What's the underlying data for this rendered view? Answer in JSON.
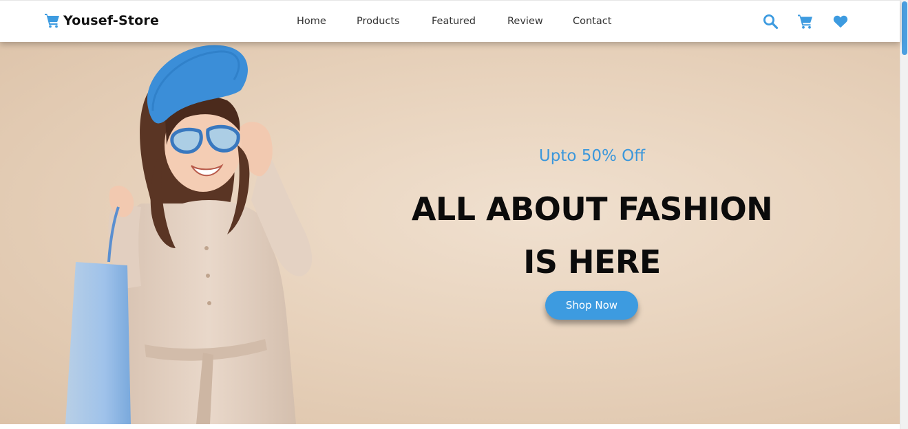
{
  "header": {
    "logo_text": "Yousef-Store",
    "logo_icon": "shopping-cart-icon",
    "nav": [
      {
        "label": "Home"
      },
      {
        "label": "Products"
      },
      {
        "label": "Featured"
      },
      {
        "label": "Review"
      },
      {
        "label": "Contact"
      }
    ],
    "icons": [
      "search-icon",
      "cart-icon",
      "heart-icon"
    ]
  },
  "hero": {
    "offer": "Upto 50% Off",
    "headline_line1": "ALL ABOUT FASHION",
    "headline_line2": "IS HERE",
    "button_label": "Shop Now"
  },
  "colors": {
    "accent": "#3d9be0",
    "hero_bg": "#e8d3bd",
    "text_dark": "#0b0b0b"
  }
}
